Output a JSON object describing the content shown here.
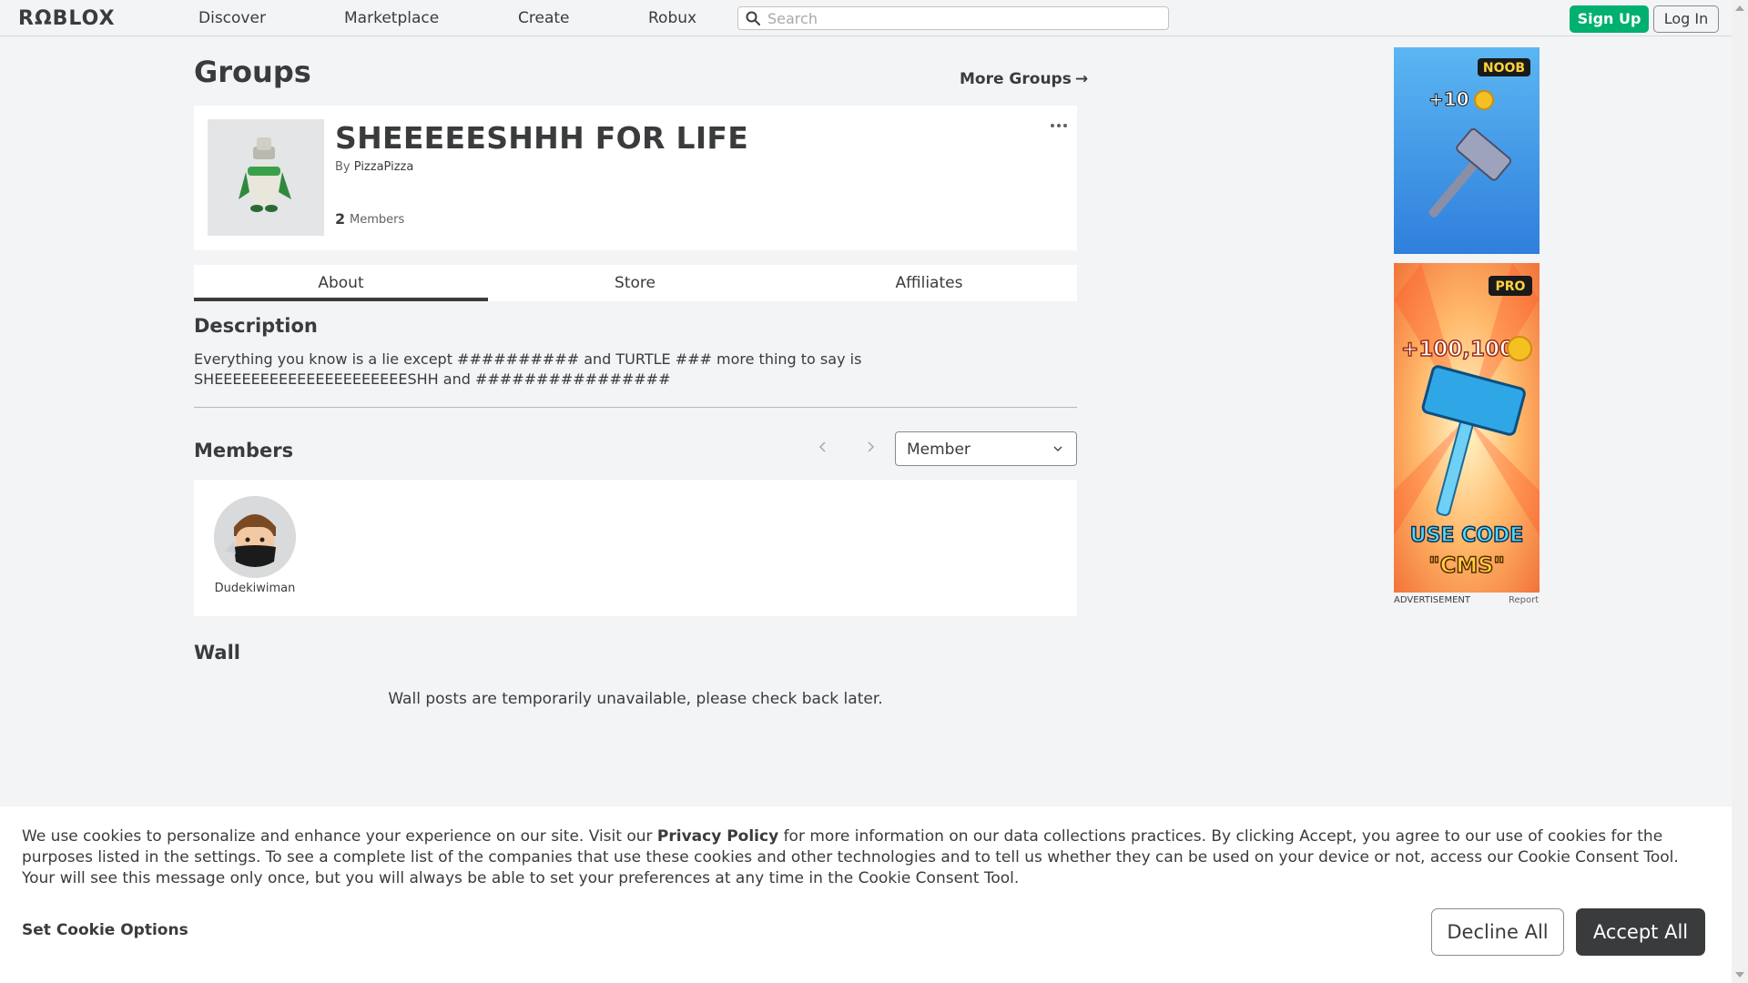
{
  "nav": {
    "logo": "RΩBLOX",
    "links": [
      "Discover",
      "Marketplace",
      "Create",
      "Robux"
    ],
    "search_placeholder": "Search",
    "signup": "Sign Up",
    "login": "Log In"
  },
  "header": {
    "title": "Groups",
    "more_groups": "More Groups",
    "more_groups_arrow": "→"
  },
  "group": {
    "name": "SHEEEEESHHH FOR LIFE",
    "by_prefix": "By",
    "owner": "PizzaPizza",
    "member_count": "2",
    "member_label": "Members"
  },
  "tabs": [
    "About",
    "Store",
    "Affiliates"
  ],
  "about": {
    "description_heading": "Description",
    "description": "Everything you know is a lie except ########## and TURTLE ### more thing to say is SHEEEEEEEEEEEEEEEEEEEEESHH and ################"
  },
  "members": {
    "heading": "Members",
    "role_filter": "Member",
    "list": [
      {
        "name": "Dudekiwiman"
      }
    ]
  },
  "wall": {
    "heading": "Wall",
    "message": "Wall posts are temporarily unavailable, please check back later."
  },
  "ads": {
    "ad1": {
      "badge": "NOOB",
      "reward": "+10"
    },
    "ad2": {
      "badge": "PRO",
      "reward": "+100,100",
      "code_line1": "USE CODE",
      "code_line2": "\"CMS\""
    },
    "label": "ADVERTISEMENT",
    "report": "Report"
  },
  "cookie": {
    "text_before": "We use cookies to personalize and enhance your experience on our site. Visit our ",
    "link": "Privacy Policy",
    "text_after": " for more information on our data collections practices. By clicking Accept, you agree to our use of cookies for the purposes listed in the settings. To see a complete list of the companies that use these cookies and other technologies and to tell us whether they can be used on your device or not, access our Cookie Consent Tool. Your will see this message only once, but you will always be able to set your preferences at any time in the Cookie Consent Tool.",
    "options": "Set Cookie Options",
    "decline": "Decline All",
    "accept": "Accept All"
  },
  "colors": {
    "accent_green": "#00b06f",
    "text_dark": "#393b3d",
    "page_bg": "#f2f4f5"
  }
}
